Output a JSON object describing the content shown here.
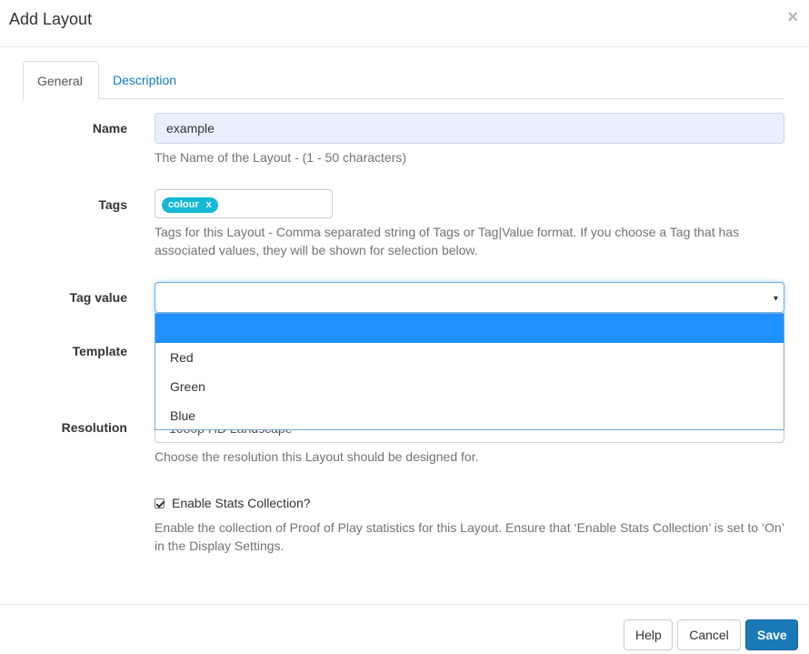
{
  "modal": {
    "title": "Add Layout",
    "close_glyph": "×"
  },
  "tabs": [
    {
      "label": "General",
      "active": true
    },
    {
      "label": "Description",
      "active": false
    }
  ],
  "fields": {
    "name": {
      "label": "Name",
      "value": "example",
      "help": "The Name of the Layout - (1 - 50 characters)"
    },
    "tags": {
      "label": "Tags",
      "chip": "colour",
      "chip_remove": "x",
      "help": "Tags for this Layout - Comma separated string of Tags or Tag|Value format. If you choose a Tag that has associated values, they will be shown for selection below."
    },
    "tag_value": {
      "label": "Tag value",
      "value": "",
      "caret": "▾",
      "options": [
        "",
        "Red",
        "Green",
        "Blue"
      ]
    },
    "template": {
      "label": "Template"
    },
    "resolution": {
      "label": "Resolution",
      "value_partial": "1080p HD Landscape",
      "help": "Choose the resolution this Layout should be designed for."
    },
    "stats": {
      "label": "Enable Stats Collection?",
      "checked": true,
      "help": "Enable the collection of Proof of Play statistics for this Layout. Ensure that ‘Enable Stats Collection’ is set to ‘On’ in the Display Settings."
    }
  },
  "footer": {
    "help_label": "Help",
    "cancel_label": "Cancel",
    "save_label": "Save"
  },
  "colors": {
    "primary": "#1a7ab8",
    "tag_chip": "#14b9d6",
    "dropdown_highlight": "#1e90ff",
    "link": "#0f7bbd"
  }
}
